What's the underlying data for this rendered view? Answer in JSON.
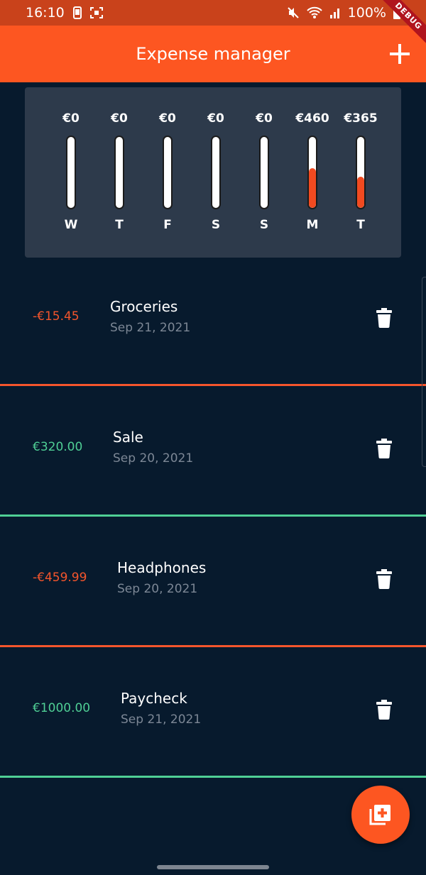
{
  "status_bar": {
    "time": "16:10",
    "battery": "100%"
  },
  "app_bar": {
    "title": "Expense manager",
    "add_icon": "plus-icon",
    "debug_banner": "DEBUG"
  },
  "chart_data": {
    "type": "bar",
    "categories": [
      "W",
      "T",
      "F",
      "S",
      "S",
      "M",
      "T"
    ],
    "value_labels": [
      "€0",
      "€0",
      "€0",
      "€0",
      "€0",
      "€460",
      "€365"
    ],
    "values": [
      0,
      0,
      0,
      0,
      0,
      460,
      365
    ],
    "fill_fractions": [
      0,
      0,
      0,
      0,
      0,
      0.56,
      0.44
    ],
    "fill_color": "#f24a20",
    "track_color": "#ffffff"
  },
  "transactions": [
    {
      "amount": "-€15.45",
      "title": "Groceries",
      "date": "Sep 21, 2021",
      "type": "expense"
    },
    {
      "amount": "€320.00",
      "title": "Sale",
      "date": "Sep 20, 2021",
      "type": "income"
    },
    {
      "amount": "-€459.99",
      "title": "Headphones",
      "date": "Sep 20, 2021",
      "type": "expense"
    },
    {
      "amount": "€1000.00",
      "title": "Paycheck",
      "date": "Sep 21, 2021",
      "type": "income"
    }
  ],
  "colors": {
    "expense": "#f4552c",
    "income": "#4fcf95",
    "accent": "#fd5621",
    "background": "#071a2d"
  },
  "fab": {
    "icon": "add-library-icon"
  }
}
